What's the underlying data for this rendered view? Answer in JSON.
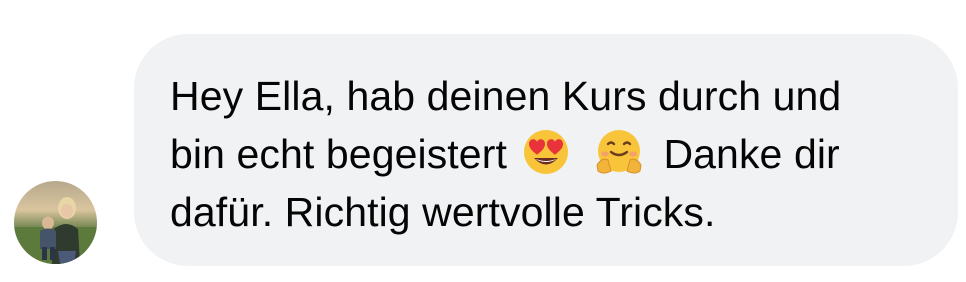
{
  "conversation": {
    "message": {
      "line1": "Hey Ella, hab deinen Kurs durch und",
      "line2_before": "bin echt begeistert",
      "line2_after": " Danke dir",
      "line3": "dafür. Richtig wertvolle Tricks.",
      "emojis": [
        "heart-eyes-emoji",
        "hugging-face-emoji"
      ]
    },
    "colors": {
      "bubble_background": "#f1f2f4",
      "text": "#050505"
    }
  }
}
